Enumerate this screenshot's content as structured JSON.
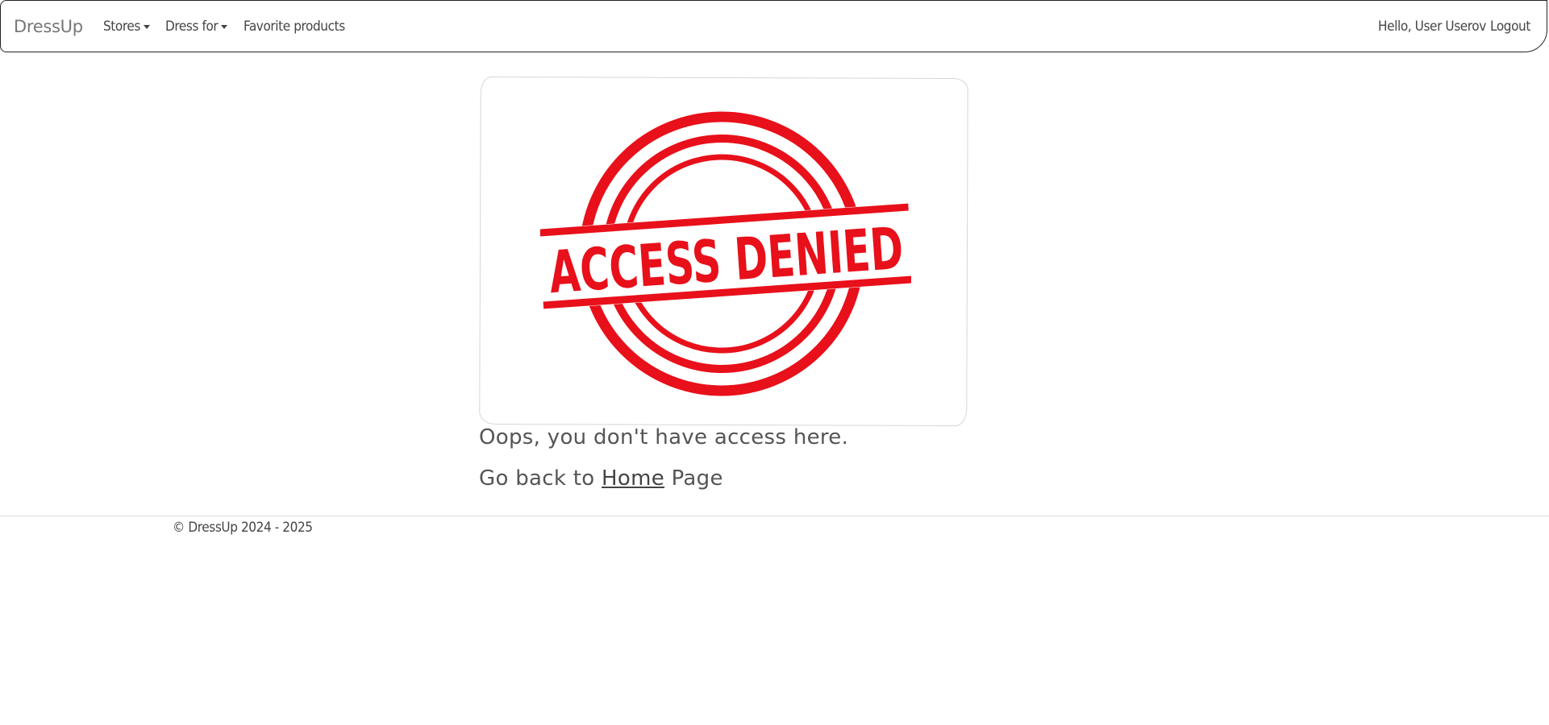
{
  "navbar": {
    "brand": "DressUp",
    "items": [
      {
        "label": "Stores",
        "dropdown": true
      },
      {
        "label": "Dress for",
        "dropdown": true
      },
      {
        "label": "Favorite products",
        "dropdown": false
      }
    ],
    "greeting": "Hello, User Userov",
    "logout": "Logout"
  },
  "error": {
    "image_text": "ACCESS DENIED",
    "stamp_color": "#e8101a",
    "message": "Oops, you don't have access here.",
    "back_prefix": "Go back to ",
    "back_link": "Home",
    "back_suffix": " Page"
  },
  "footer": {
    "text": "© DressUp 2024 - 2025"
  }
}
